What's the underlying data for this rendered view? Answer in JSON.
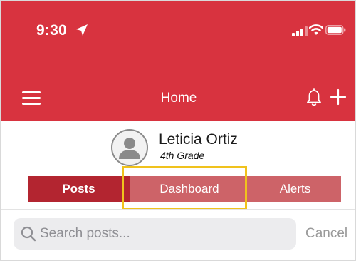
{
  "status_bar": {
    "time": "9:30"
  },
  "nav": {
    "title": "Home"
  },
  "profile": {
    "name": "Leticia Ortiz",
    "grade": "4th Grade"
  },
  "tabs": [
    {
      "label": "Posts",
      "active": true
    },
    {
      "label": "Dashboard",
      "active": false,
      "highlighted": true
    },
    {
      "label": "Alerts",
      "active": false
    }
  ],
  "search": {
    "placeholder": "Search posts...",
    "cancel_label": "Cancel"
  },
  "colors": {
    "brand": "#d8333f",
    "tab_active": "#b32530",
    "tab_inactive": "#cd6368",
    "highlight": "#f0c21d"
  }
}
